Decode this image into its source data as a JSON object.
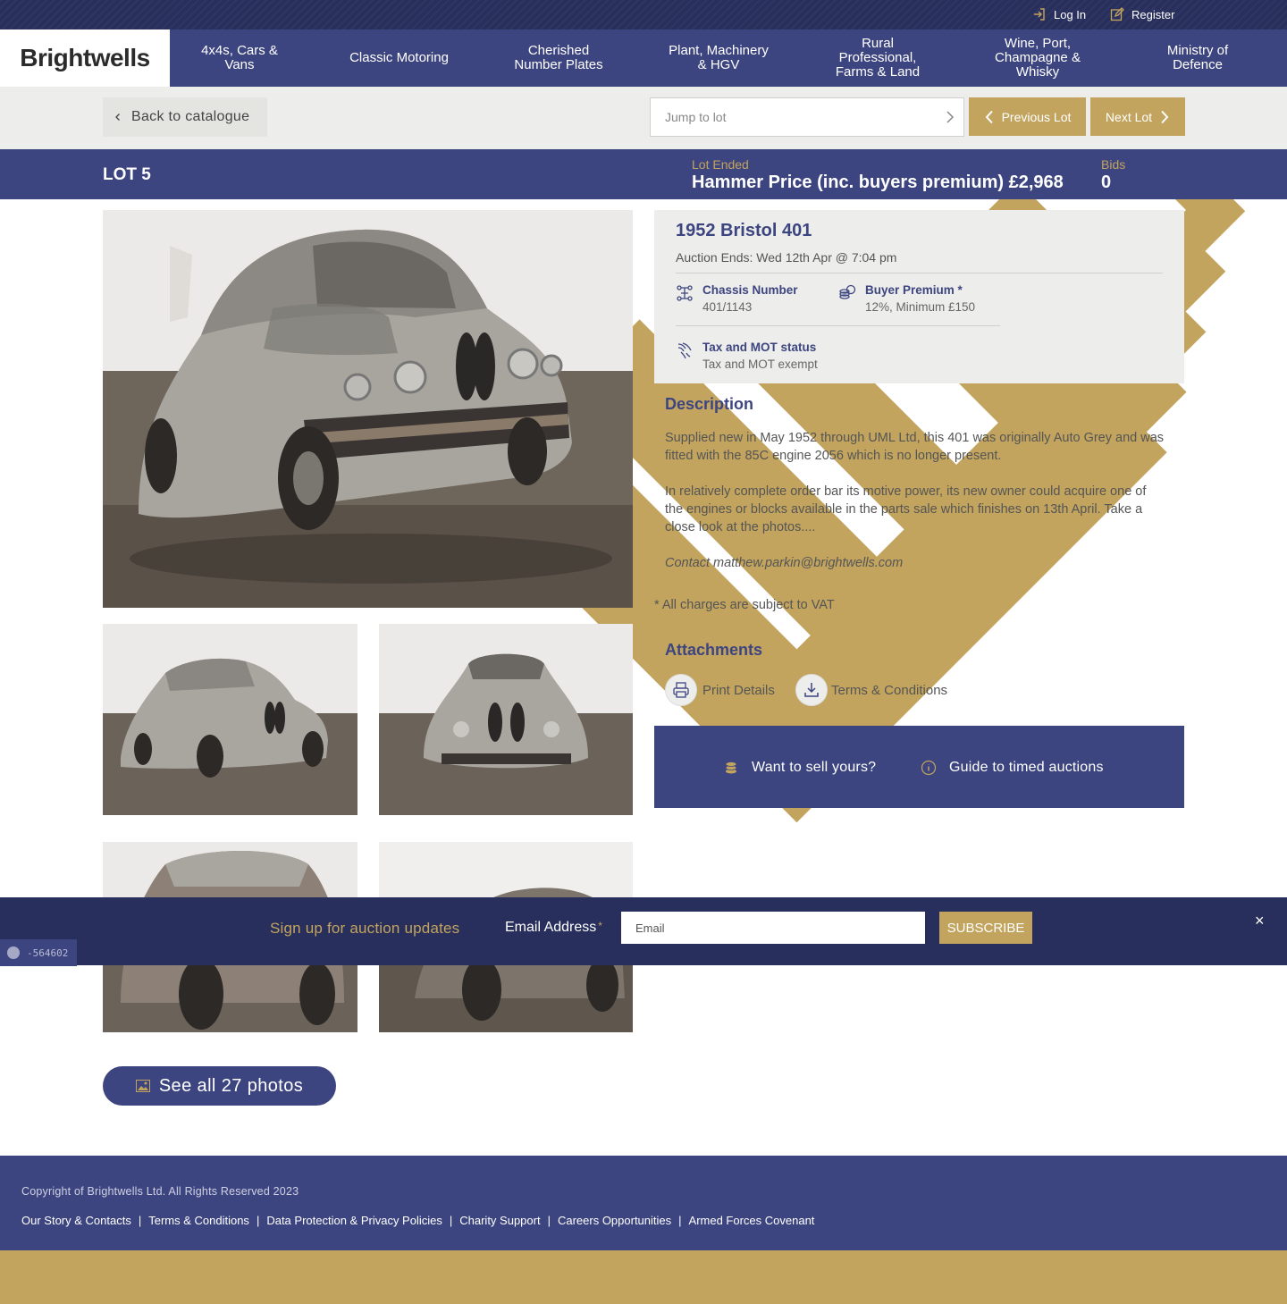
{
  "header": {
    "login_label": "Log In",
    "register_label": "Register",
    "logo_text": "Brightwells"
  },
  "nav": {
    "items": [
      {
        "label": "4x4s, Cars &\nVans"
      },
      {
        "label": "Classic Motoring"
      },
      {
        "label": "Cherished\nNumber Plates"
      },
      {
        "label": "Plant, Machinery\n& HGV"
      },
      {
        "label": "Rural\nProfessional,\nFarms & Land"
      },
      {
        "label": "Wine, Port,\nChampagne &\nWhisky"
      },
      {
        "label": "Ministry of\nDefence"
      }
    ]
  },
  "subbar": {
    "back_label": "Back to catalogue",
    "jump_placeholder": "Jump to lot",
    "previous_label": "Previous Lot",
    "next_label": "Next Lot"
  },
  "lot": {
    "number_label": "LOT 5",
    "status_label": "Lot Ended",
    "hammer_label": "Hammer Price (inc. buyers premium) £2,968",
    "bids_label": "Bids",
    "bids_value": "0"
  },
  "details": {
    "title": "1952 Bristol 401",
    "auction_ends": "Auction Ends: Wed 12th Apr @ 7:04 pm",
    "chassis_label": "Chassis Number",
    "chassis_value": "401/1143",
    "premium_label": "Buyer Premium *",
    "premium_value": "12%, Minimum £150",
    "tax_label": "Tax and MOT status",
    "tax_value": "Tax and MOT exempt"
  },
  "description": {
    "heading": "Description",
    "p1": "Supplied new in May 1952 through UML Ltd, this 401 was originally Auto Grey and was fitted with the 85C engine 2056 which is no longer present.",
    "p2": "In relatively complete order bar its motive power, its new owner could acquire one of the engines or blocks available in the parts sale which finishes on 13th April. Take a close look at the photos....",
    "contact": "Contact matthew.parkin@brightwells.com",
    "vat_note": "* All charges are subject to VAT"
  },
  "attachments": {
    "heading": "Attachments",
    "print_label": "Print Details",
    "terms_label": "Terms & Conditions"
  },
  "promo": {
    "sell_label": "Want to sell yours?",
    "guide_label": "Guide to timed auctions"
  },
  "gallery": {
    "see_all_label": "See all 27 photos"
  },
  "signup": {
    "heading": "Sign up for auction updates",
    "email_label": "Email Address",
    "required_mark": "*",
    "email_placeholder": "Email",
    "subscribe_label": "SUBSCRIBE",
    "close_glyph": "×"
  },
  "badge": {
    "text": "-564602"
  },
  "footer": {
    "copyright": "Copyright of Brightwells Ltd. All Rights Reserved 2023",
    "links": [
      "Our Story & Contacts",
      "Terms & Conditions",
      "Data Protection & Privacy Policies",
      "Charity Support",
      "Careers Opportunities",
      "Armed Forces Covenant"
    ],
    "separator": "|"
  },
  "colors": {
    "navy": "#3d4580",
    "dark_navy": "#282f5c",
    "gold": "#c2a45e",
    "light_grey": "#ededeb"
  },
  "icons": [
    "login-icon",
    "register-icon",
    "chevron-down-icon",
    "chevron-left-icon",
    "chevron-right-icon",
    "chassis-icon",
    "coins-icon",
    "document-icon",
    "print-icon",
    "download-icon",
    "info-icon",
    "image-icon",
    "close-icon"
  ]
}
